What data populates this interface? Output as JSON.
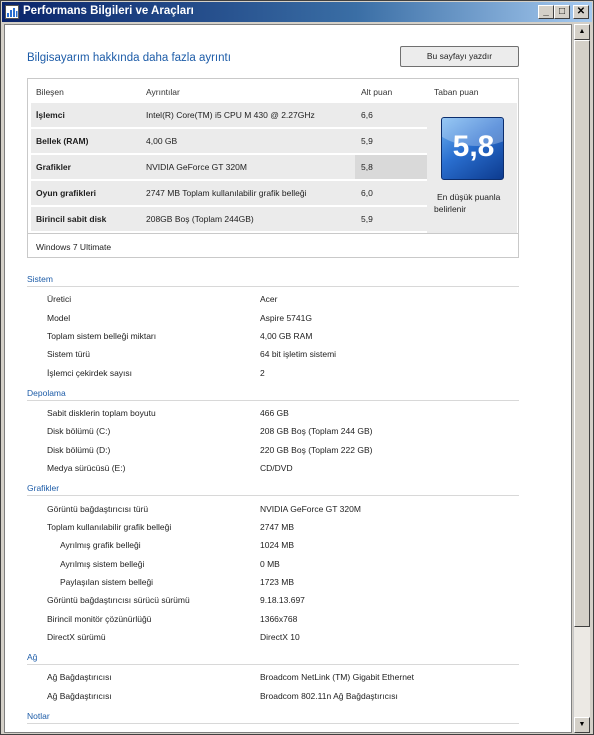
{
  "window": {
    "title": "Performans Bilgileri ve Araçları",
    "minimize_glyph": "_",
    "maximize_glyph": "□",
    "close_glyph": "✕"
  },
  "page": {
    "heading": "Bilgisayarım hakkında daha fazla ayrıntı",
    "print_button": "Bu sayfayı yazdır"
  },
  "score_table": {
    "headers": [
      "Bileşen",
      "Ayrıntılar",
      "Alt puan",
      "Taban puan"
    ],
    "rows": [
      {
        "component": "İşlemci",
        "details": "Intel(R) Core(TM) i5 CPU M 430 @ 2.27GHz",
        "subscore": "6,6"
      },
      {
        "component": "Bellek (RAM)",
        "details": "4,00 GB",
        "subscore": "5,9"
      },
      {
        "component": "Grafikler",
        "details": "NVIDIA GeForce GT 320M",
        "subscore": "5,8"
      },
      {
        "component": "Oyun grafikleri",
        "details": "2747 MB Toplam kullanılabilir grafik belleği",
        "subscore": "6,0"
      },
      {
        "component": "Birincil sabit disk",
        "details": "208GB Boş (Toplam 244GB)",
        "subscore": "5,9"
      }
    ],
    "highlighted_row_index": 2,
    "base_score": "5,8",
    "base_caption_line1": "En düşük puanla",
    "base_caption_line2": "belirlenir",
    "os": "Windows 7 Ultimate",
    "badge_colors": {
      "top": "#6fb3f0",
      "mid": "#2a6fd0",
      "bottom": "#0d3b8f"
    }
  },
  "sections": {
    "system": {
      "title": "Sistem",
      "items": [
        {
          "label": "Üretici",
          "value": "Acer"
        },
        {
          "label": "Model",
          "value": "Aspire 5741G"
        },
        {
          "label": "Toplam sistem belleği miktarı",
          "value": "4,00 GB RAM"
        },
        {
          "label": "Sistem türü",
          "value": "64 bit işletim sistemi"
        },
        {
          "label": "İşlemci çekirdek sayısı",
          "value": "2"
        }
      ]
    },
    "storage": {
      "title": "Depolama",
      "items": [
        {
          "label": "Sabit disklerin toplam boyutu",
          "value": "466 GB"
        },
        {
          "label": "Disk bölümü (C:)",
          "value": "208 GB Boş (Toplam 244 GB)"
        },
        {
          "label": "Disk bölümü (D:)",
          "value": "220 GB Boş (Toplam 222 GB)"
        },
        {
          "label": "Medya sürücüsü (E:)",
          "value": "CD/DVD"
        }
      ]
    },
    "graphics": {
      "title": "Grafikler",
      "items": [
        {
          "label": "Görüntü bağdaştırıcısı türü",
          "value": "NVIDIA GeForce GT 320M"
        },
        {
          "label": "Toplam kullanılabilir grafik belleği",
          "value": "2747 MB"
        },
        {
          "label": "Ayrılmış grafik belleği",
          "value": "1024 MB"
        },
        {
          "label": "Ayrılmış sistem belleği",
          "value": "0 MB"
        },
        {
          "label": "Paylaşılan sistem belleği",
          "value": "1723 MB"
        },
        {
          "label": "Görüntü bağdaştırıcısı sürücü sürümü",
          "value": "9.18.13.697"
        },
        {
          "label": "Birincil monitör çözünürlüğü",
          "value": "1366x768"
        },
        {
          "label": "DirectX sürümü",
          "value": "DirectX 10"
        }
      ]
    },
    "network": {
      "title": "Ağ",
      "items": [
        {
          "label": "Ağ Bağdaştırıcısı",
          "value": "Broadcom NetLink (TM) Gigabit Ethernet"
        },
        {
          "label": "Ağ Bağdaştırıcısı",
          "value": "Broadcom 802.11n Ağ Bağdaştırıcısı"
        }
      ]
    },
    "notes": {
      "title": "Notlar"
    }
  },
  "scrollbar": {
    "up_glyph": "▲",
    "down_glyph": "▼"
  },
  "colors": {
    "accent": "#1d5ca8",
    "title_bar_start": "#0a246a",
    "title_bar_end": "#a6caf0",
    "row_background": "#ebebeb",
    "highlight_cell": "#d9d9d9"
  }
}
